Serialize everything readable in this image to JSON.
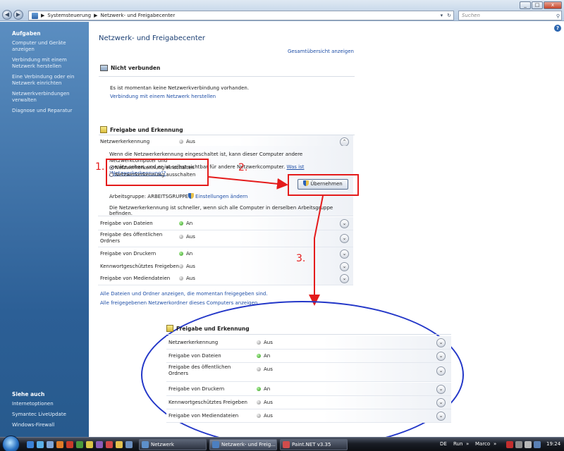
{
  "window": {
    "btn_minimize": "_",
    "btn_restore": "□",
    "btn_close": "x"
  },
  "address": {
    "back": "◀",
    "forward": "▶",
    "crumb_sep": "▶",
    "crumb1": "Systemsteuerung",
    "crumb2": "Netzwerk- und Freigabecenter",
    "dropdown": "▾",
    "refresh": "↻",
    "search_placeholder": "Suchen",
    "search_icon": "⚲"
  },
  "sidebar": {
    "heading": "Aufgaben",
    "items": [
      "Computer und Geräte anzeigen",
      "Verbindung mit einem Netzwerk herstellen",
      "Eine Verbindung oder ein Netzwerk einrichten",
      "Netzwerkverbindungen verwalten",
      "Diagnose und Reparatur"
    ],
    "see_also_heading": "Siehe auch",
    "see_also": [
      "Internetoptionen",
      "Symantec LiveUpdate",
      "Windows-Firewall"
    ]
  },
  "main": {
    "help": "?",
    "title": "Netzwerk- und Freigabecenter",
    "overview_link": "Gesamtübersicht anzeigen",
    "not_connected_heading": "Nicht verbunden",
    "no_connection_text": "Es ist momentan keine Netzwerkverbindung vorhanden.",
    "connect_link": "Verbindung mit einem Netzwerk herstellen",
    "sharing_heading": "Freigabe und Erkennung",
    "discovery": {
      "label": "Netzwerkerkennung",
      "status": "Aus",
      "chev": "⌃",
      "desc_line1": "Wenn die Netzwerkerkennung eingeschaltet ist, kann dieser Computer andere Netzwerkcomputer und",
      "desc_line2": "-geräte sehen, und er ist selbst sichtbar für andere Netzwerkcomputer.",
      "desc_link": "Was ist \"Netzwerkerkennung\"?",
      "option_on": "Netzwerkerkennung einschalten",
      "option_off": "Netzwerkerkennung ausschalten",
      "workgroup": "Arbeitsgruppe: ARBEITSGRUPPE",
      "settings_link": "Einstellungen ändern",
      "apply": "Übernehmen",
      "hint": "Die Netzwerkerkennung ist schneller, wenn sich alle Computer in derselben Arbeitsgruppe befinden."
    },
    "rows": [
      {
        "label": "Freigabe von Dateien",
        "status": "An"
      },
      {
        "label": "Freigabe des öffentlichen",
        "label2": "Ordners",
        "status": "Aus"
      },
      {
        "label": "Freigabe von Druckern",
        "status": "An"
      },
      {
        "label": "Kennwortgeschütztes Freigeben",
        "status": "Aus"
      },
      {
        "label": "Freigabe von Mediendateien",
        "status": "Aus"
      }
    ],
    "chev_down": "⌄",
    "show_files_link": "Alle Dateien und Ordner anzeigen, die momentan freigegeben sind.",
    "show_shares_link": "Alle freigegebenen Netzwerkordner dieses Computers anzeigen."
  },
  "annotations": {
    "n1": "1.",
    "n2": "2.",
    "n3": "3."
  },
  "zoom": {
    "heading": "Freigabe und Erkennung",
    "rows": [
      {
        "label": "Netzwerkerkennung",
        "status": "Aus"
      },
      {
        "label": "Freigabe von Dateien",
        "status": "An"
      },
      {
        "label": "Freigabe des öffentlichen",
        "label2": "Ordners",
        "status": "Aus"
      },
      {
        "label": "Freigabe von Druckern",
        "status": "An"
      },
      {
        "label": "Kennwortgeschütztes Freigeben",
        "status": "Aus"
      },
      {
        "label": "Freigabe von Mediendateien",
        "status": "Aus"
      }
    ]
  },
  "taskbar": {
    "tasks": [
      "Netzwerk",
      "Netzwerk- und Freig...",
      "Paint.NET v3.35"
    ],
    "lang": "DE",
    "run": "Run",
    "more1": "»",
    "user": "Marco",
    "more2": "»",
    "clock": "19:24"
  },
  "colors": {
    "annotation_red": "#e41b1b",
    "annotation_blue": "#2337c8",
    "sidebar_blue": "#2c5f96"
  }
}
